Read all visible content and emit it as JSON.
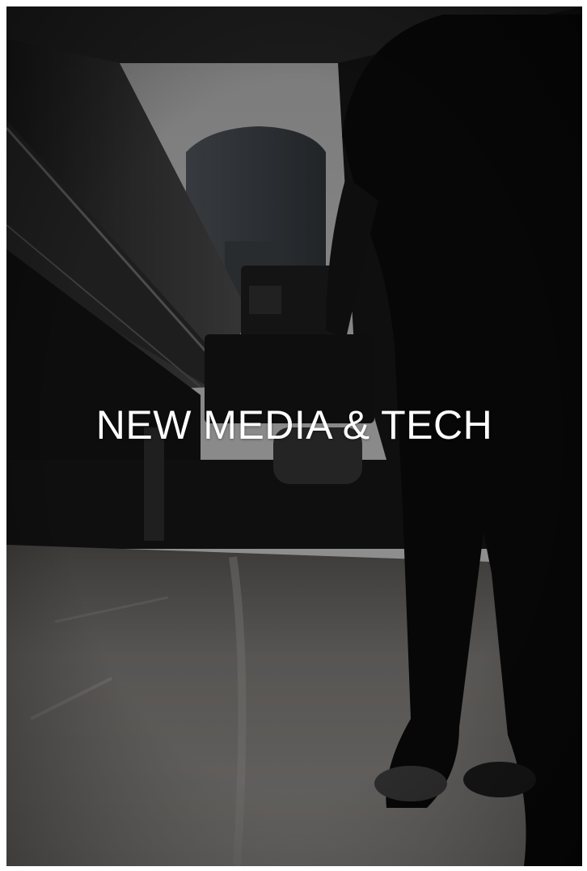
{
  "banner": {
    "title": "NEW MEDIA & TECH"
  },
  "photo": {
    "subject": "person holding a video camera under a highway overpass",
    "colors": {
      "sky": "#b9b9b9",
      "overpass": "#3b3b3b",
      "road": "#8a8784",
      "silhouette": "#0b0b0b"
    }
  }
}
